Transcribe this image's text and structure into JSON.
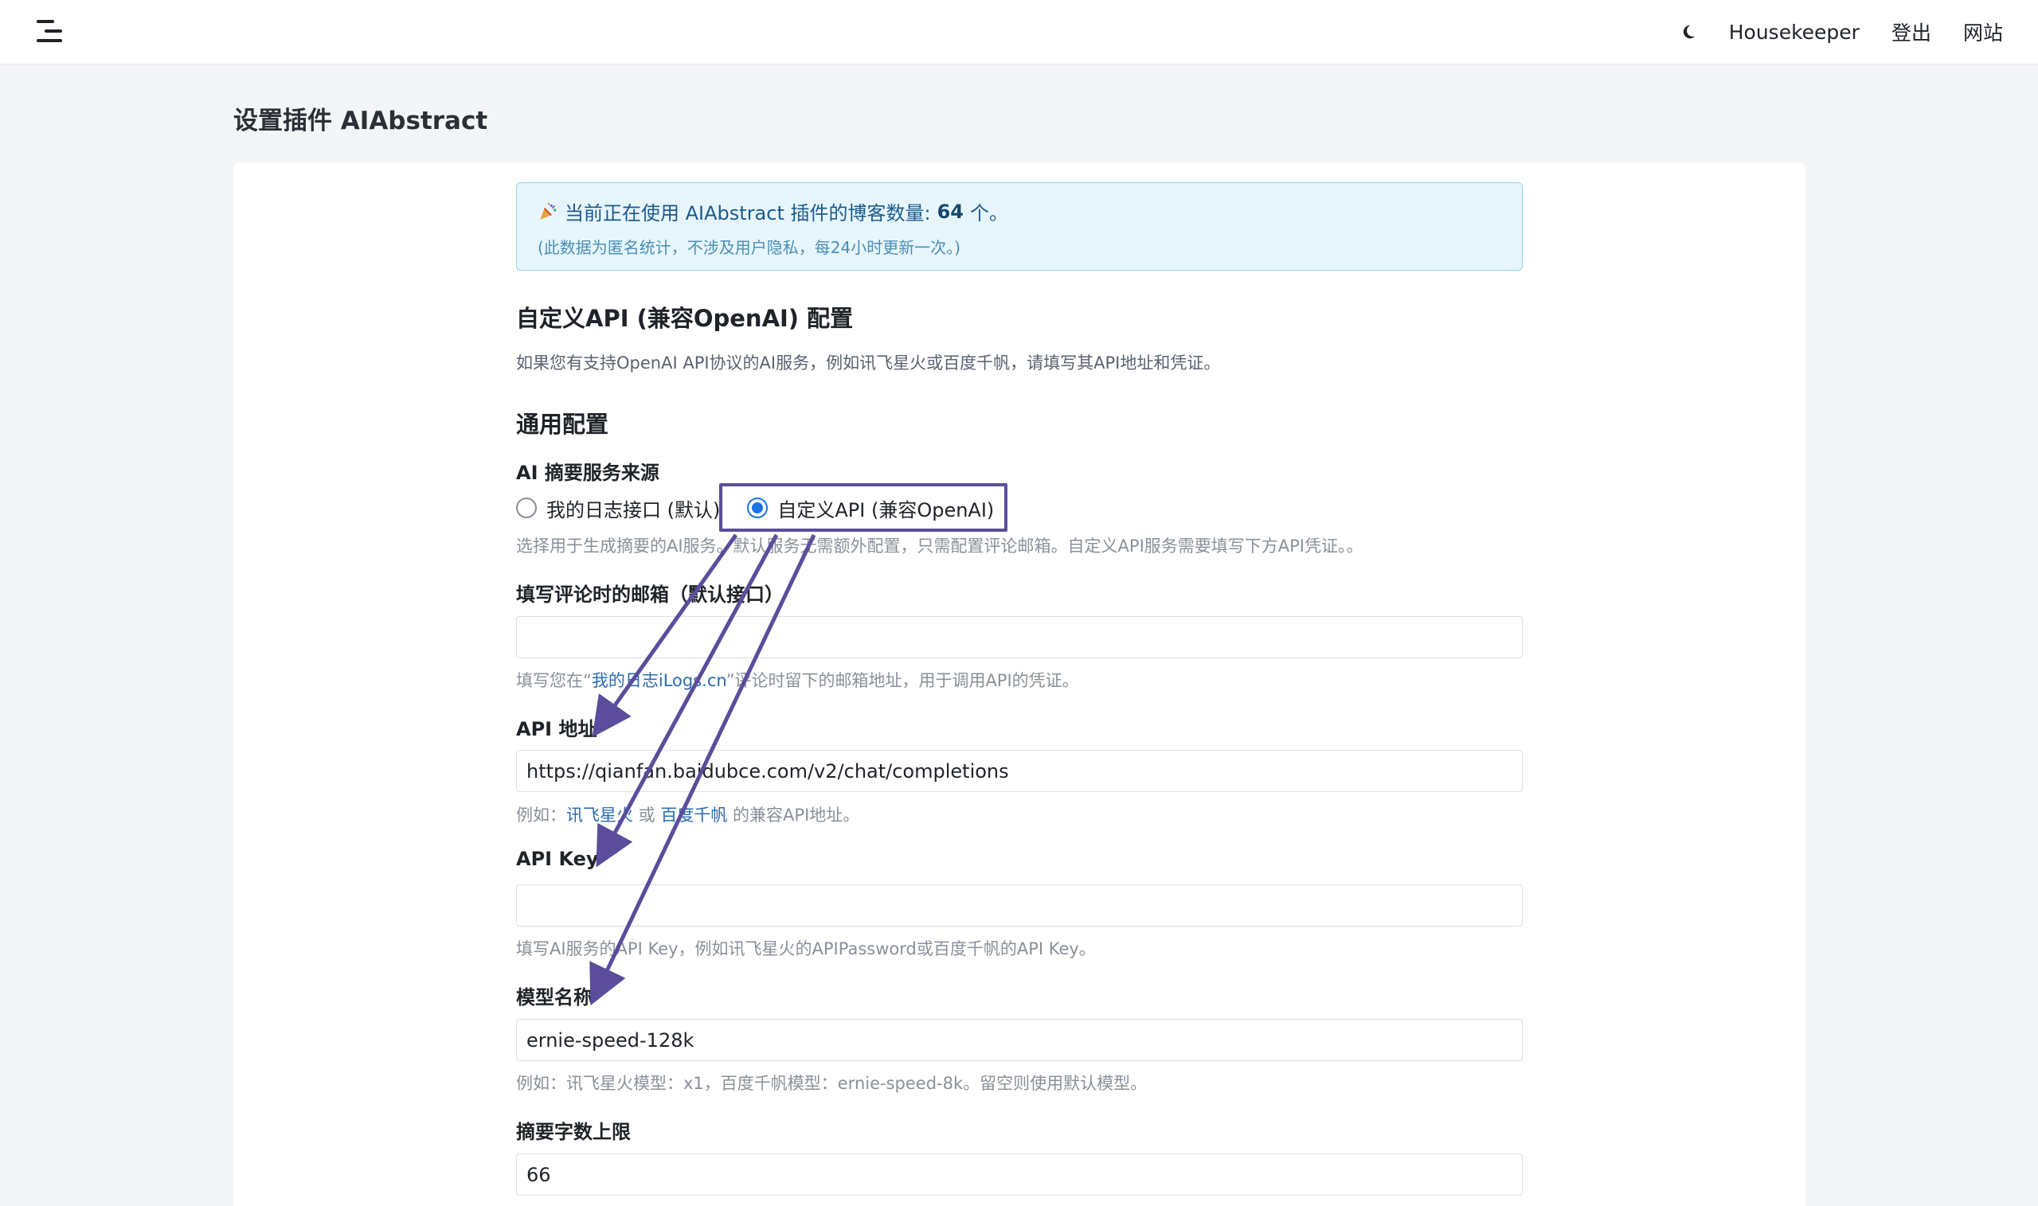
{
  "nav": {
    "items": [
      "Housekeeper",
      "登出",
      "网站"
    ]
  },
  "page": {
    "title": "设置插件 AIAbstract"
  },
  "notice": {
    "prefix": "当前正在使用 AIAbstract 插件的博客数量:",
    "count": "64",
    "suffix": "个。",
    "subtext": "(此数据为匿名统计，不涉及用户隐私，每24小时更新一次。)"
  },
  "custom_api": {
    "heading": "自定义API (兼容OpenAI) 配置",
    "description": "如果您有支持OpenAI API协议的AI服务，例如讯飞星火或百度千帆，请填写其API地址和凭证。"
  },
  "general": {
    "heading": "通用配置"
  },
  "source": {
    "label": "AI 摘要服务来源",
    "option_default": "我的日志接口 (默认)",
    "option_custom": "自定义API (兼容OpenAI)",
    "selected": "custom",
    "help": "选择用于生成摘要的AI服务。默认服务无需额外配置，只需配置评论邮箱。自定义API服务需要填写下方API凭证。。"
  },
  "email": {
    "label": "填写评论时的邮箱（默认接口）",
    "value": "",
    "help_prefix": "填写您在“",
    "help_link": "我的日志iLogs.cn",
    "help_suffix": "”评论时留下的邮箱地址，用于调用API的凭证。"
  },
  "api_url": {
    "label": "API 地址",
    "value": "https://qianfan.baidubce.com/v2/chat/completions",
    "help_prefix": "例如：",
    "link1": "讯飞星火",
    "help_or": " 或 ",
    "link2": "百度千帆",
    "help_suffix": " 的兼容API地址。"
  },
  "api_key": {
    "label": "API Key",
    "value": "",
    "help": "填写AI服务的API Key，例如讯飞星火的APIPassword或百度千帆的API Key。"
  },
  "model": {
    "label": "模型名称",
    "value": "ernie-speed-128k",
    "help": "例如：讯飞星火模型：x1，百度千帆模型：ernie-speed-8k。留空则使用默认模型。"
  },
  "limit": {
    "label": "摘要字数上限",
    "value": "66"
  },
  "colors": {
    "annotation": "#5b4d9b",
    "radio_accent": "#1a73e8",
    "notice_bg": "#e7f6fd"
  }
}
